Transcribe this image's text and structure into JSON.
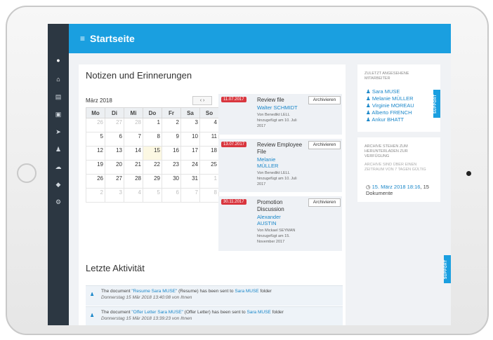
{
  "header": {
    "title": "Startseite"
  },
  "sidebar": {
    "icons": [
      "user-icon",
      "home-icon",
      "document-icon",
      "files-icon",
      "send-icon",
      "group-icon",
      "cloud-icon",
      "tag-icon",
      "gear-icon"
    ]
  },
  "notes": {
    "heading": "Notizen und Erinnerungen",
    "calendar": {
      "month": "März 2018",
      "nav": "‹ ›",
      "weekdays": [
        "Mo",
        "Di",
        "Mi",
        "Do",
        "Fr",
        "Sa",
        "So"
      ],
      "weeks": [
        [
          "26",
          "27",
          "28",
          "1",
          "2",
          "3",
          "4"
        ],
        [
          "5",
          "6",
          "7",
          "8",
          "9",
          "10",
          "11"
        ],
        [
          "12",
          "13",
          "14",
          "15",
          "16",
          "17",
          "18"
        ],
        [
          "19",
          "20",
          "21",
          "22",
          "23",
          "24",
          "25"
        ],
        [
          "26",
          "27",
          "28",
          "29",
          "30",
          "31",
          "1"
        ],
        [
          "2",
          "3",
          "4",
          "5",
          "6",
          "7",
          "8"
        ]
      ],
      "today": "15"
    },
    "items": [
      {
        "date": "11.07.2017",
        "title": "Review file",
        "person": "Walter SCHMIDT",
        "meta": "Von Benedikt LELL hinzugefügt am 10. Juli 2017",
        "archive": "Archivieren"
      },
      {
        "date": "13.07.2017",
        "title": "Review Employee File",
        "person": "Melanie MÜLLER",
        "meta": "Von Benedikt LELL hinzugefügt am 10. Juli 2017",
        "archive": "Archivieren"
      },
      {
        "date": "30.11.2017",
        "title": "Promotion Discussion",
        "person": "Alexander AUSTIN",
        "meta": "Von Mickael SEYMAN hinzugefügt am 15. November 2017",
        "archive": "Archivieren"
      }
    ]
  },
  "activity": {
    "heading": "Letzte Aktivität",
    "items": [
      {
        "pre": "The document ",
        "doc": "\"Resume Sara MUSE\"",
        "mid": " (Resume) has been sent to ",
        "who": "Sara MUSE",
        "post": " folder",
        "time": "Donnerstag 15 Mär 2018 13:40:08 von Ihnen"
      },
      {
        "pre": "The document ",
        "doc": "\"Offer Letter Sara MUSE\"",
        "mid": " (Offer Letter) has been sent to ",
        "who": "Sara MUSE",
        "post": " folder",
        "time": "Donnerstag 15 Mär 2018 13:39:23 von Ihnen"
      }
    ]
  },
  "recent": {
    "heading": "ZULETZT ANGESEHENE MITARBEITER",
    "people": [
      "Sara MUSE",
      "Melanie MÜLLER",
      "Virginie MOREAU",
      "Alberto FRENCH",
      "Ankur BHATT"
    ]
  },
  "archive": {
    "heading": "ARCHIVE STEHEN ZUM HERUNTERLADEN ZUR VERFÜGUNG",
    "sub": "ARCHIVE SIND ÜBER EINEN ZEITRAUM VON 7 TAGEN GÜLTIG",
    "link": "15. März 2018 18:16",
    "suffix": ", 15 Dokumente"
  },
  "support": {
    "label": "SUPPORT"
  },
  "colors": {
    "primary": "#1a9fe0",
    "sidebar": "#2c3742",
    "badge": "#d9363e"
  }
}
